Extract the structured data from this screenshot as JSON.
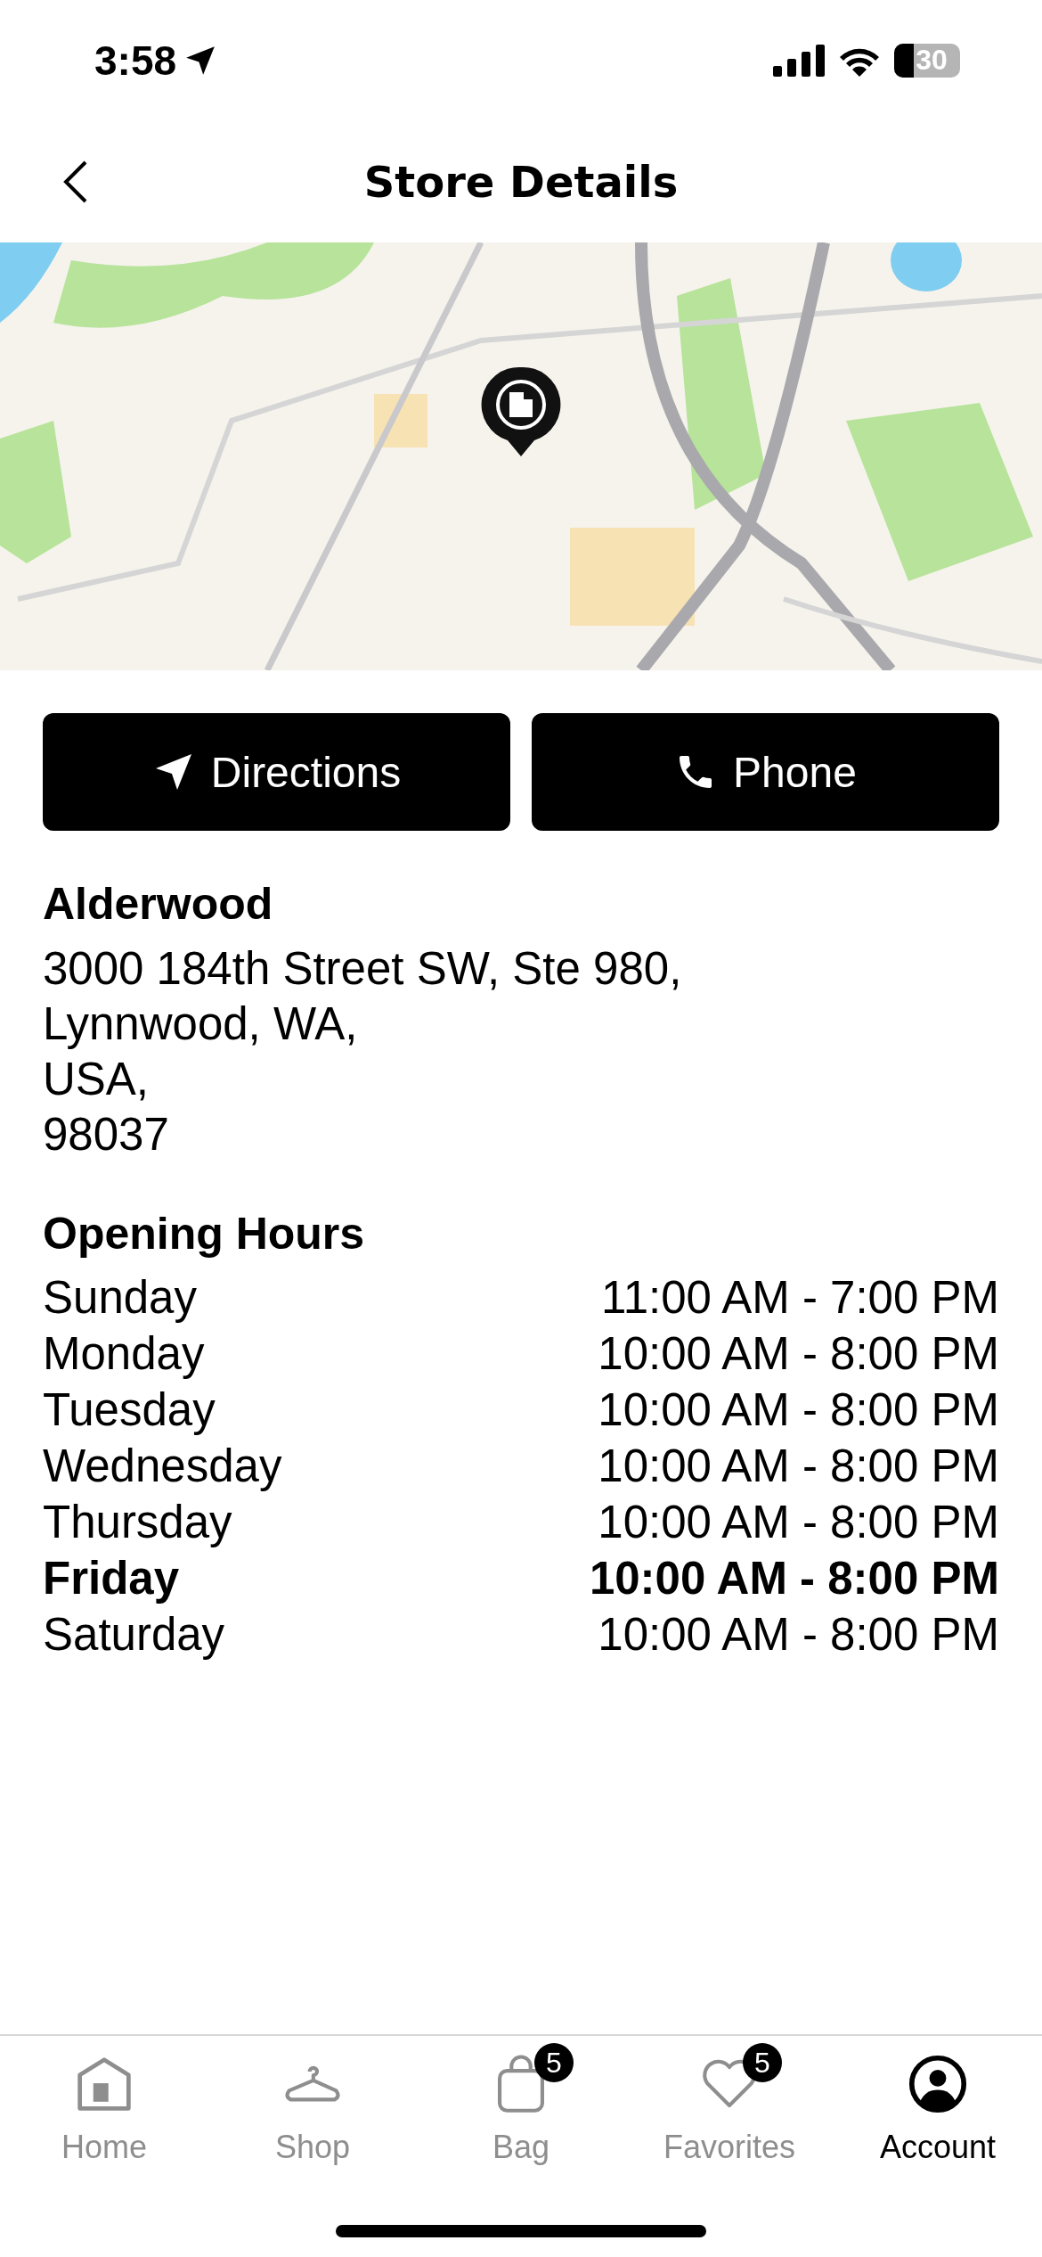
{
  "status_bar": {
    "time": "3:58",
    "battery": "30"
  },
  "nav": {
    "title": "Store Details"
  },
  "actions": [
    {
      "kind": "directions",
      "label": "Directions"
    },
    {
      "kind": "phone",
      "label": "Phone"
    }
  ],
  "store": {
    "name": "Alderwood",
    "address": [
      "3000 184th Street SW, Ste 980,",
      "Lynnwood, WA,",
      "USA,",
      "98037"
    ]
  },
  "hours": {
    "title": "Opening Hours",
    "rows": [
      {
        "day": "Sunday",
        "time": "11:00 AM - 7:00 PM",
        "today": false
      },
      {
        "day": "Monday",
        "time": "10:00 AM - 8:00 PM",
        "today": false
      },
      {
        "day": "Tuesday",
        "time": "10:00 AM - 8:00 PM",
        "today": false
      },
      {
        "day": "Wednesday",
        "time": "10:00 AM - 8:00 PM",
        "today": false
      },
      {
        "day": "Thursday",
        "time": "10:00 AM - 8:00 PM",
        "today": false
      },
      {
        "day": "Friday",
        "time": "10:00 AM - 8:00 PM",
        "today": true
      },
      {
        "day": "Saturday",
        "time": "10:00 AM - 8:00 PM",
        "today": false
      }
    ]
  },
  "tab_bar": [
    {
      "kind": "home",
      "label": "Home",
      "selected": false
    },
    {
      "kind": "shop",
      "label": "Shop",
      "selected": false
    },
    {
      "kind": "bag",
      "label": "Bag",
      "selected": false,
      "badge": "5"
    },
    {
      "kind": "favorites",
      "label": "Favorites",
      "selected": false,
      "badge": "5"
    },
    {
      "kind": "account",
      "label": "Account",
      "selected": true
    }
  ]
}
